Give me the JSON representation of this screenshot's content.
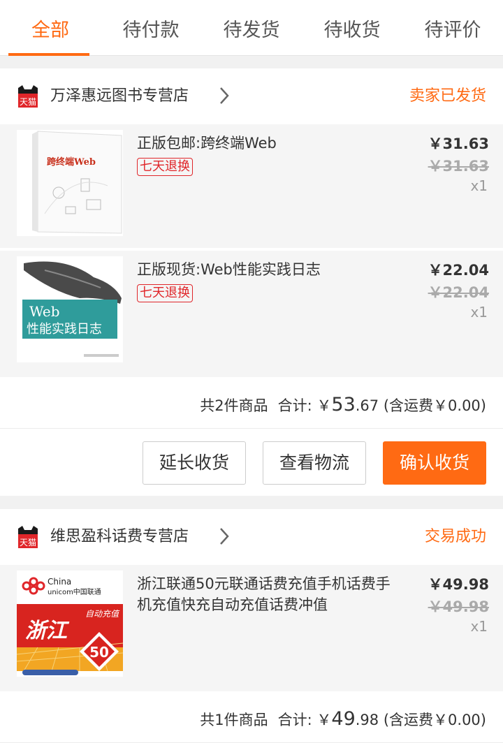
{
  "tabs": [
    {
      "label": "全部",
      "active": true
    },
    {
      "label": "待付款",
      "active": false
    },
    {
      "label": "待发货",
      "active": false
    },
    {
      "label": "待收货",
      "active": false
    },
    {
      "label": "待评价",
      "active": false
    }
  ],
  "tmall_logo_text": "天猫",
  "orders": [
    {
      "shop_name": "万泽惠远图书专营店",
      "status": "卖家已发货",
      "items": [
        {
          "title": "正版包邮:跨终端Web",
          "badge": "七天退换",
          "price": "￥31.63",
          "original_price": "￥31.63",
          "quantity": "x1",
          "cover_text": "跨终端Web"
        },
        {
          "title": "正版现货:Web性能实践日志",
          "badge": "七天退换",
          "price": "￥22.04",
          "original_price": "￥22.04",
          "quantity": "x1",
          "cover_line1": "Web",
          "cover_line2": "性能实践日志"
        }
      ],
      "summary": {
        "count_text": "共2件商品",
        "total_label": "合计: ",
        "currency": "￥",
        "total_int": "53",
        "total_dec": ".67",
        "shipping_text": "(含运费￥0.00)"
      },
      "actions": [
        "延长收货",
        "查看物流",
        "确认收货"
      ]
    },
    {
      "shop_name": "维思盈科话费专营店",
      "status": "交易成功",
      "items": [
        {
          "title": "浙江联通50元联通话费充值手机话费手机充值快充自动充值话费冲值",
          "price": "￥49.98",
          "original_price": "￥49.98",
          "quantity": "x1",
          "logo_line1": "China",
          "logo_line2": "unicom中国联通",
          "cover_province": "浙江",
          "cover_auto": "自动充值",
          "cover_amount": "50"
        }
      ],
      "summary": {
        "count_text": "共1件商品",
        "total_label": "合计: ",
        "currency": "￥",
        "total_int": "49",
        "total_dec": ".98",
        "shipping_text": "(含运费￥0.00)"
      }
    }
  ],
  "colors": {
    "accent": "#ff6a13",
    "badge_red": "#e0262a",
    "tmall_red": "#e0262a"
  }
}
